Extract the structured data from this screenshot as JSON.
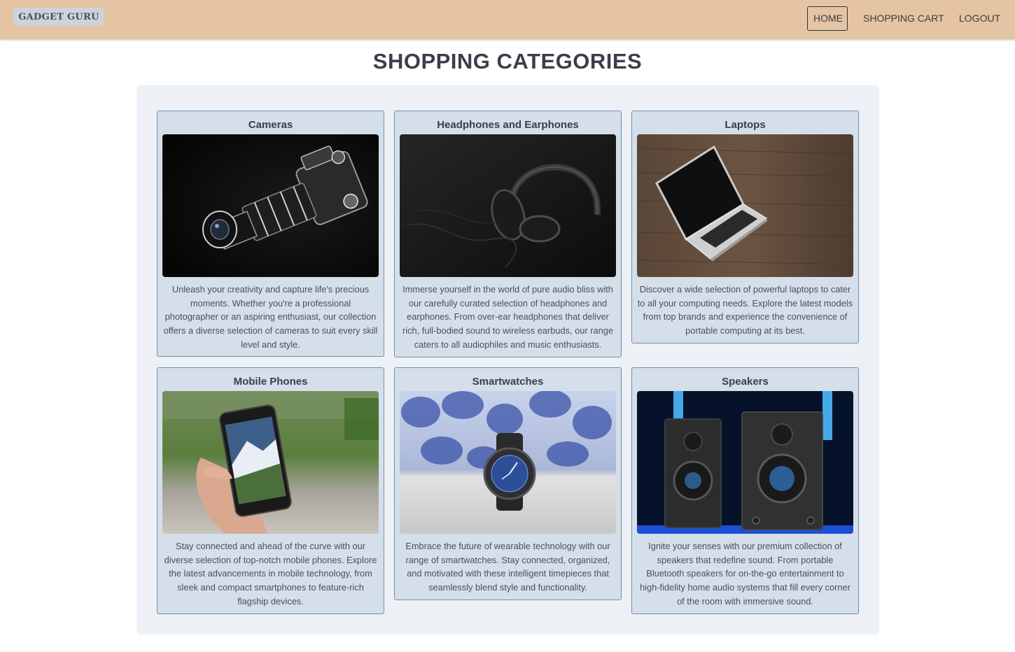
{
  "navbar": {
    "brand": "GADGET GURU",
    "links": [
      {
        "label": "HOME",
        "active": true
      },
      {
        "label": "SHOPPING CART",
        "active": false
      },
      {
        "label": "LOGOUT",
        "active": false
      }
    ]
  },
  "page_title": "SHOPPING CATEGORIES",
  "categories": [
    {
      "title": "Cameras",
      "image": "camera-photo",
      "description": "Unleash your creativity and capture life's precious moments. Whether you're a professional photographer or an aspiring enthusiast, our collection offers a diverse selection of cameras to suit every skill level and style."
    },
    {
      "title": "Headphones and Earphones",
      "image": "headphones-photo",
      "description": "Immerse yourself in the world of pure audio bliss with our carefully curated selection of headphones and earphones. From over-ear headphones that deliver rich, full-bodied sound to wireless earbuds, our range caters to all audiophiles and music enthusiasts."
    },
    {
      "title": "Laptops",
      "image": "laptop-photo",
      "description": "Discover a wide selection of powerful laptops to cater to all your computing needs. Explore the latest models from top brands and experience the convenience of portable computing at its best."
    },
    {
      "title": "Mobile Phones",
      "image": "mobile-phone-photo",
      "description": "Stay connected and ahead of the curve with our diverse selection of top-notch mobile phones. Explore the latest advancements in mobile technology, from sleek and compact smartphones to feature-rich flagship devices."
    },
    {
      "title": "Smartwatches",
      "image": "smartwatch-photo",
      "description": "Embrace the future of wearable technology with our range of smartwatches. Stay connected, organized, and motivated with these intelligent timepieces that seamlessly blend style and functionality."
    },
    {
      "title": "Speakers",
      "image": "speakers-photo",
      "description": "Ignite your senses with our premium collection of speakers that redefine sound. From portable Bluetooth speakers for on-the-go entertainment to high-fidelity home audio systems that fill every corner of the room with immersive sound."
    }
  ],
  "colors": {
    "navbar_bg": "#e4c4a3",
    "panel_bg": "#edf1f6",
    "card_bg": "#d5dfe9",
    "card_border": "#6f8fb3"
  }
}
